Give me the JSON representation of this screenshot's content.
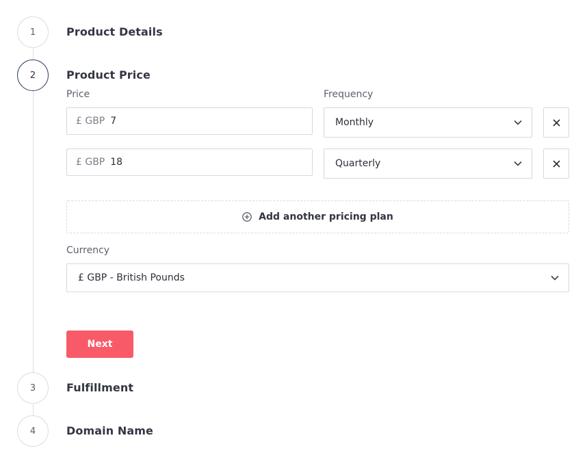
{
  "steps": [
    {
      "number": "1",
      "title": "Product Details"
    },
    {
      "number": "2",
      "title": "Product Price"
    },
    {
      "number": "3",
      "title": "Fulfillment"
    },
    {
      "number": "4",
      "title": "Domain Name"
    }
  ],
  "price_section": {
    "price_label": "Price",
    "frequency_label": "Frequency",
    "plans": [
      {
        "currency_prefix": "£ GBP",
        "price": "7",
        "frequency": "Monthly"
      },
      {
        "currency_prefix": "£ GBP",
        "price": "18",
        "frequency": "Quarterly"
      }
    ],
    "add_plan_label": "Add another pricing plan",
    "currency_label": "Currency",
    "currency_value": "£ GBP - British Pounds",
    "next_label": "Next"
  },
  "colors": {
    "accent": "#f85a67",
    "active_step_border": "#34435e",
    "border": "#d6d8dd"
  },
  "icons": {
    "remove": "close-icon",
    "dropdown": "chevron-down-icon",
    "add": "plus-circle-icon"
  }
}
